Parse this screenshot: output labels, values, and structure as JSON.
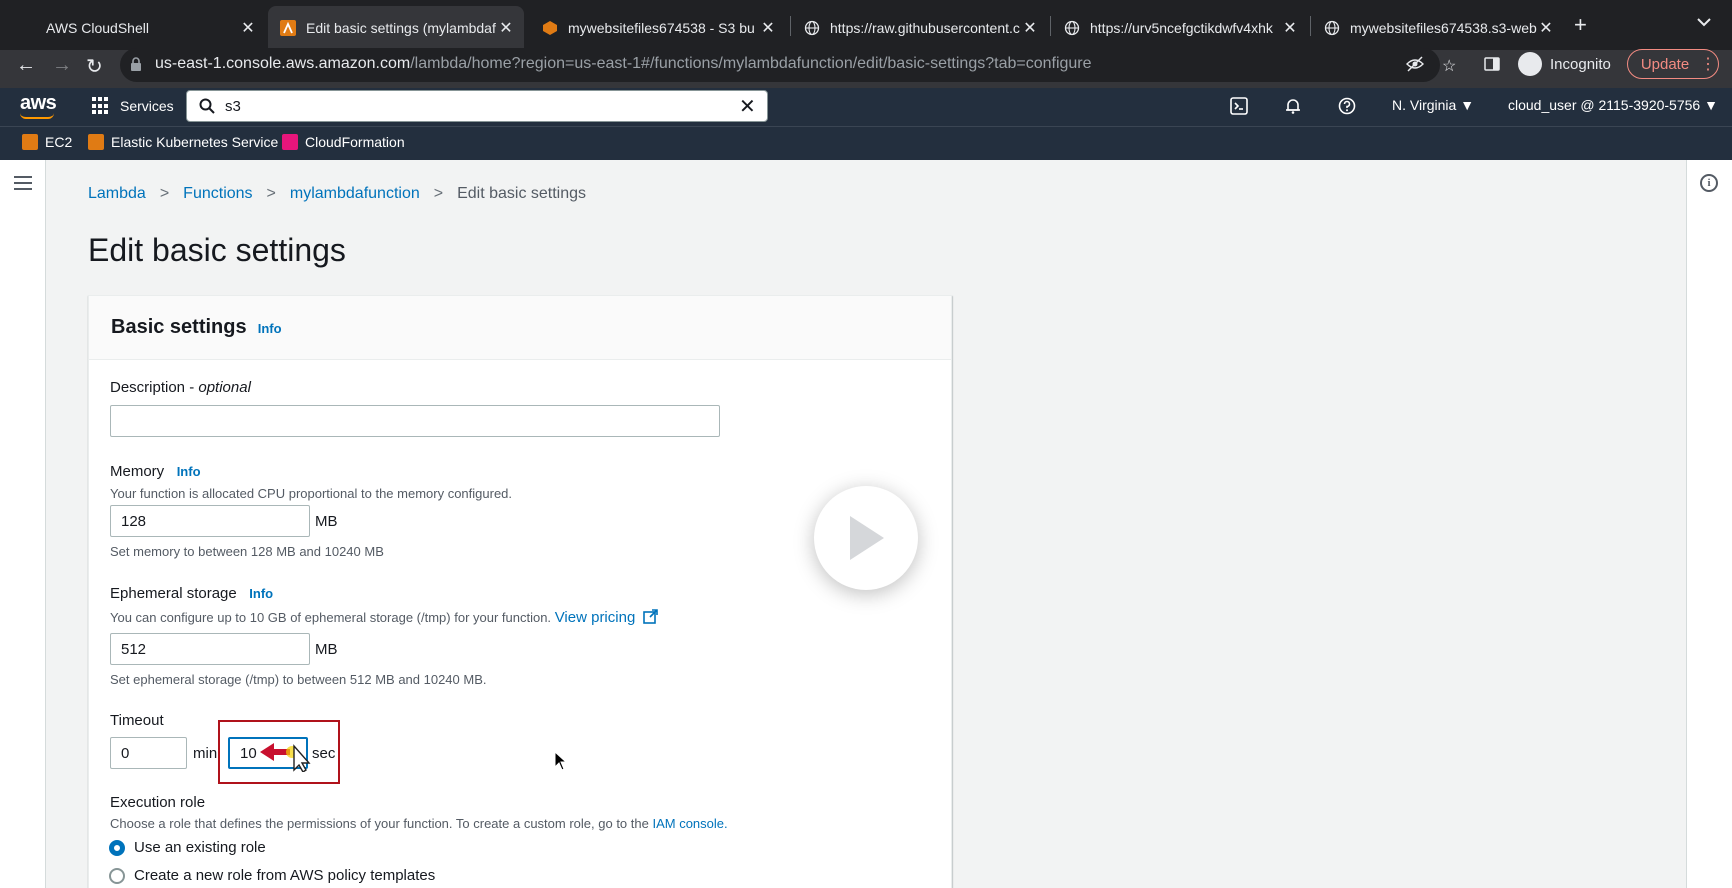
{
  "browser": {
    "tabs": [
      {
        "title": "AWS CloudShell",
        "active": false
      },
      {
        "title": "Edit basic settings (mylambdaf",
        "active": true
      },
      {
        "title": "mywebsitefiles674538 - S3 bu",
        "active": false
      },
      {
        "title": "https://raw.githubusercontent.c",
        "active": false
      },
      {
        "title": "https://urv5ncefgctikdwfv4xhk",
        "active": false
      },
      {
        "title": "mywebsitefiles674538.s3-web",
        "active": false
      }
    ],
    "url_host": "us-east-1.console.aws.amazon.com",
    "url_path": "/lambda/home?region=us-east-1#/functions/mylambdafunction/edit/basic-settings?tab=configure",
    "incognito_label": "Incognito",
    "update_label": "Update"
  },
  "aws_nav": {
    "logo": "aws",
    "services_label": "Services",
    "search_value": "s3",
    "region": "N. Virginia",
    "account": "cloud_user @ 2115-3920-5756"
  },
  "favorites": [
    {
      "label": "EC2",
      "color": "#e07b14"
    },
    {
      "label": "Elastic Kubernetes Service",
      "color": "#e07b14"
    },
    {
      "label": "CloudFormation",
      "color": "#e7157b"
    }
  ],
  "breadcrumb": {
    "items": [
      "Lambda",
      "Functions",
      "mylambdafunction"
    ],
    "current": "Edit basic settings"
  },
  "page_title": "Edit basic settings",
  "panel": {
    "title": "Basic settings",
    "info": "Info",
    "description_label": "Description - ",
    "description_optional": "optional",
    "description_value": "",
    "memory": {
      "label": "Memory",
      "info": "Info",
      "desc": "Your function is allocated CPU proportional to the memory configured.",
      "value": "128",
      "unit": "MB",
      "hint": "Set memory to between 128 MB and 10240 MB"
    },
    "ephemeral": {
      "label": "Ephemeral storage",
      "info": "Info",
      "desc": "You can configure up to 10 GB of ephemeral storage (/tmp) for your function.",
      "link": "View pricing",
      "value": "512",
      "unit": "MB",
      "hint": "Set ephemeral storage (/tmp) to between 512 MB and 10240 MB."
    },
    "timeout": {
      "label": "Timeout",
      "min_value": "0",
      "min_unit": "min",
      "sec_value": "10",
      "sec_unit": "sec"
    },
    "execution_role": {
      "label": "Execution role",
      "desc": "Choose a role that defines the permissions of your function. To create a custom role, go to the",
      "link": "IAM console.",
      "options": [
        {
          "label": "Use an existing role",
          "selected": true
        },
        {
          "label": "Create a new role from AWS policy templates",
          "selected": false
        }
      ]
    }
  },
  "colors": {
    "aws_nav_bg": "#232f3e",
    "link": "#0073bb",
    "highlight_box": "#b0121b"
  }
}
